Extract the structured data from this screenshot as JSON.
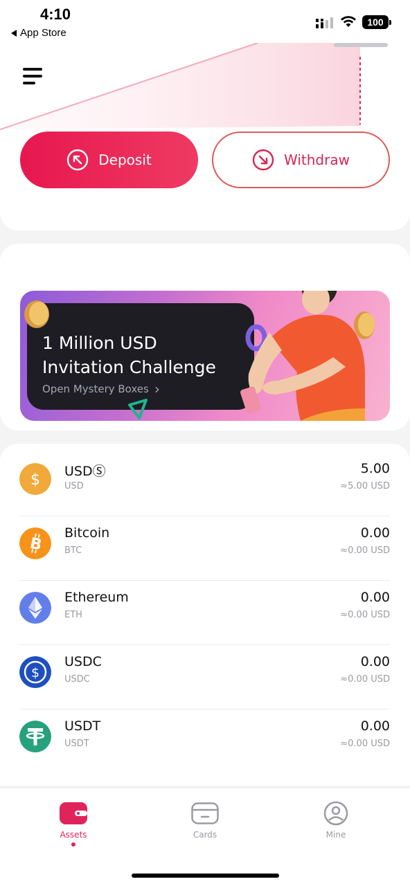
{
  "status_bar": {
    "time": "4:10",
    "back_label": "App Store",
    "battery": "100"
  },
  "header": {
    "menu_icon": "hamburger-menu-icon"
  },
  "actions": {
    "deposit_label": "Deposit",
    "withdraw_label": "Withdraw",
    "accent_color": "#e7174f"
  },
  "promo": {
    "title": "1 Million USD\nInvitation Challenge",
    "subtitle": "Open Mystery Boxes",
    "chevron": "›"
  },
  "assets": [
    {
      "name": "USDⓈ",
      "ticker": "USD",
      "amount": "5.00",
      "usd_value": "≈5.00 USD",
      "icon": "usd-icon",
      "color": "#f0a93a"
    },
    {
      "name": "Bitcoin",
      "ticker": "BTC",
      "amount": "0.00",
      "usd_value": "≈0.00 USD",
      "icon": "bitcoin-icon",
      "color": "#f7931a"
    },
    {
      "name": "Ethereum",
      "ticker": "ETH",
      "amount": "0.00",
      "usd_value": "≈0.00 USD",
      "icon": "ethereum-icon",
      "color": "#627eea"
    },
    {
      "name": "USDC",
      "ticker": "USDC",
      "amount": "0.00",
      "usd_value": "≈0.00 USD",
      "icon": "usdc-icon",
      "color": "#2775ca"
    },
    {
      "name": "USDT",
      "ticker": "USDT",
      "amount": "0.00",
      "usd_value": "≈0.00 USD",
      "icon": "tether-icon",
      "color": "#26a17b"
    }
  ],
  "tabs": [
    {
      "label": "Assets",
      "icon": "wallet-icon",
      "active": true
    },
    {
      "label": "Cards",
      "icon": "card-icon",
      "active": false
    },
    {
      "label": "Mine",
      "icon": "profile-icon",
      "active": false
    }
  ]
}
